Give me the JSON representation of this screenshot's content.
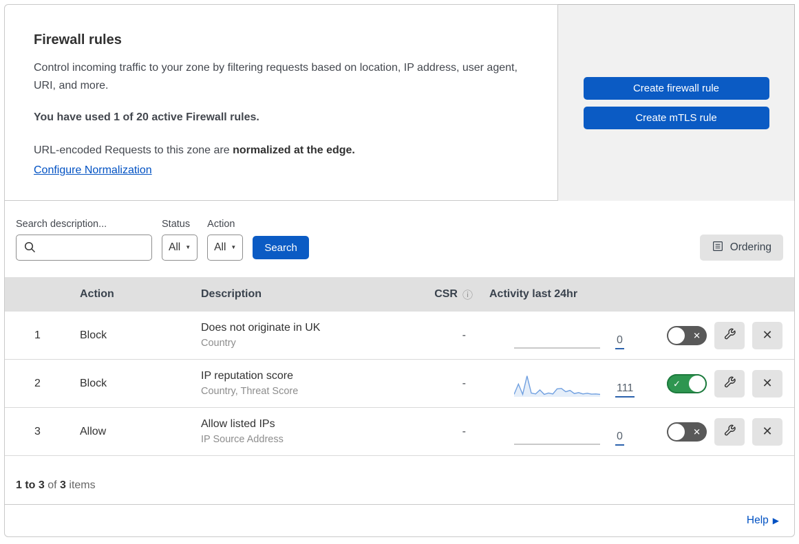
{
  "header": {
    "title": "Firewall rules",
    "description": "Control incoming traffic to your zone by filtering requests based on location, IP address, user agent, URI, and more.",
    "usage": "You have used 1 of 20 active Firewall rules.",
    "normalization_text": "URL-encoded Requests to this zone are ",
    "normalization_bold": "normalized at the edge.",
    "normalization_link": "Configure Normalization"
  },
  "actions_panel": {
    "create_firewall_label": "Create firewall rule",
    "create_mtls_label": "Create mTLS rule"
  },
  "filters": {
    "search_label": "Search description...",
    "search_value": "",
    "status_label": "Status",
    "status_value": "All",
    "action_label": "Action",
    "action_value": "All",
    "search_button": "Search",
    "ordering_button": "Ordering"
  },
  "table": {
    "headers": {
      "action": "Action",
      "description": "Description",
      "csr": "CSR",
      "activity": "Activity last 24hr"
    },
    "rows": [
      {
        "num": "1",
        "action": "Block",
        "description": "Does not originate in UK",
        "criteria": "Country",
        "csr": "-",
        "activity_count": "0",
        "enabled": false
      },
      {
        "num": "2",
        "action": "Block",
        "description": "IP reputation score",
        "criteria": "Country, Threat Score",
        "csr": "-",
        "activity_count": "111",
        "enabled": true,
        "sparkline": [
          8,
          55,
          8,
          92,
          14,
          10,
          28,
          8,
          14,
          10,
          33,
          35,
          20,
          26,
          12,
          16,
          10,
          13,
          9,
          10,
          8
        ]
      },
      {
        "num": "3",
        "action": "Allow",
        "description": "Allow listed IPs",
        "criteria": "IP Source Address",
        "csr": "-",
        "activity_count": "0",
        "enabled": false
      }
    ]
  },
  "pagination": {
    "range": "1 to 3",
    "of_text": " of ",
    "total": "3",
    "items_text": " items"
  },
  "footer": {
    "help_label": "Help"
  },
  "colors": {
    "primary_blue": "#0b5bc4",
    "link_blue": "#0051c3",
    "toggle_on_green": "#2e9650",
    "toggle_off_gray": "#595959",
    "sparkline_blue": "#6f9fe0",
    "table_header_gray": "#e0e0e0"
  }
}
